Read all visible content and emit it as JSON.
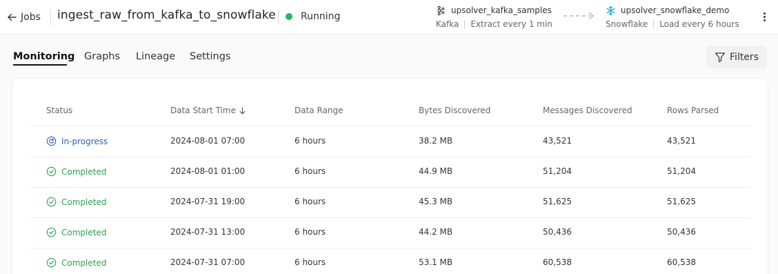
{
  "header": {
    "back_label": "Jobs",
    "job_name": "ingest_raw_from_kafka_to_snowflake",
    "status": "Running",
    "status_color": "#1dbb62",
    "source": {
      "name": "upsolver_kafka_samples",
      "type": "Kafka",
      "schedule": "Extract every 1 min",
      "icon": "kafka-icon"
    },
    "destination": {
      "name": "upsolver_snowflake_demo",
      "type": "Snowflake",
      "schedule": "Load every 6 hours",
      "icon": "snowflake-icon",
      "icon_color": "#29b5e8"
    }
  },
  "tabs": [
    {
      "label": "Monitoring",
      "active": true
    },
    {
      "label": "Graphs",
      "active": false
    },
    {
      "label": "Lineage",
      "active": false
    },
    {
      "label": "Settings",
      "active": false
    }
  ],
  "filters_label": "Filters",
  "table": {
    "columns": [
      "Status",
      "Data Start Time",
      "Data Range",
      "Bytes Discovered",
      "Messages Discovered",
      "Rows Parsed"
    ],
    "sort_column": "Data Start Time",
    "sort_direction": "descending",
    "rows": [
      {
        "status": "In-progress",
        "start": "2024-08-01 07:00",
        "range": "6 hours",
        "bytes": "38.2 MB",
        "messages": "43,521",
        "rows": "43,521"
      },
      {
        "status": "Completed",
        "start": "2024-08-01 01:00",
        "range": "6 hours",
        "bytes": "44.9 MB",
        "messages": "51,204",
        "rows": "51,204"
      },
      {
        "status": "Completed",
        "start": "2024-07-31 19:00",
        "range": "6 hours",
        "bytes": "45.3 MB",
        "messages": "51,625",
        "rows": "51,625"
      },
      {
        "status": "Completed",
        "start": "2024-07-31 13:00",
        "range": "6 hours",
        "bytes": "44.2 MB",
        "messages": "50,436",
        "rows": "50,436"
      },
      {
        "status": "Completed",
        "start": "2024-07-31 07:00",
        "range": "6 hours",
        "bytes": "53.1 MB",
        "messages": "60,538",
        "rows": "60,538"
      }
    ],
    "status_colors": {
      "In-progress": "#2b5fb8",
      "Completed": "#2e9e4f"
    }
  }
}
